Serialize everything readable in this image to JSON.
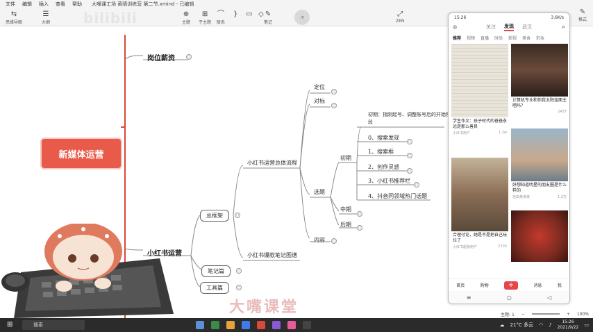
{
  "menubar": {
    "items": [
      "文件",
      "编辑",
      "插入",
      "查看",
      "帮助"
    ],
    "title": "大嘴课工场 黄晴训练营 第二节.xmind - 已编辑"
  },
  "toolbar": {
    "left": [
      "思维导图",
      "大纲"
    ],
    "center": [
      "主题",
      "子主题",
      "联系",
      "",
      "",
      "",
      "笔记"
    ],
    "zen": "ZEN",
    "watermark": "bilibili"
  },
  "right_panel": {
    "label": "格式"
  },
  "mindmap": {
    "root": "新媒体运营",
    "branches": [
      "岗位薪资",
      "小红书运营"
    ],
    "xhs_children": [
      "总框架",
      "笔记篇",
      "工具篇"
    ],
    "framework_children": [
      "小红书运营总体流程",
      "小红书爆款笔记图谱"
    ],
    "process_children": [
      "定位",
      "对标",
      "选题",
      "内容"
    ],
    "topic_children": [
      "初期",
      "中期",
      "后期"
    ],
    "early_note": "初期：指刚起号、调整账号后的开始阶",
    "early_note_line2": "段",
    "early_items": [
      "0、搜索发现",
      "1、搜索框",
      "2、创作灵感",
      "3、小红书推荐栏",
      "4、抖音同领域热门话题"
    ]
  },
  "phone": {
    "time": "15:26",
    "signal": "3.6K/s",
    "tabs": [
      "关注",
      "发现",
      "武汉"
    ],
    "active_tab": "发现",
    "categories": [
      "推荐",
      "视频",
      "直播",
      "时尚",
      "影视",
      "美食",
      "彩妆"
    ],
    "cards": [
      {
        "caption": "学生作文：孩子时代的爸爸永远是那么善良",
        "user": "小红书用户",
        "likes": "1,2w"
      },
      {
        "caption": "计算机专业和你我太阳挂面主唱吗？",
        "user": "",
        "likes": "2437"
      },
      {
        "caption": "好想知道明星的朋友圈是什么样的",
        "user": "自由美食家",
        "likes": "1.2万"
      },
      {
        "caption": "合理讨论，她是不是把自己玩烂了",
        "user": "小红书超级用户",
        "likes": "2703"
      }
    ],
    "nav": [
      "首页",
      "购物",
      "+",
      "消息",
      "我"
    ]
  },
  "app_status": {
    "topic": "主题: 1",
    "zoom": "100%"
  },
  "taskbar": {
    "search": "搜索",
    "weather": "21°C 多云",
    "time": "15:26",
    "date": "2021/9/22"
  },
  "brand_watermark": "大嘴课堂",
  "colors": {
    "root": "#e85b4a",
    "accent": "#e8454a",
    "branch_line": "#d9483a"
  }
}
